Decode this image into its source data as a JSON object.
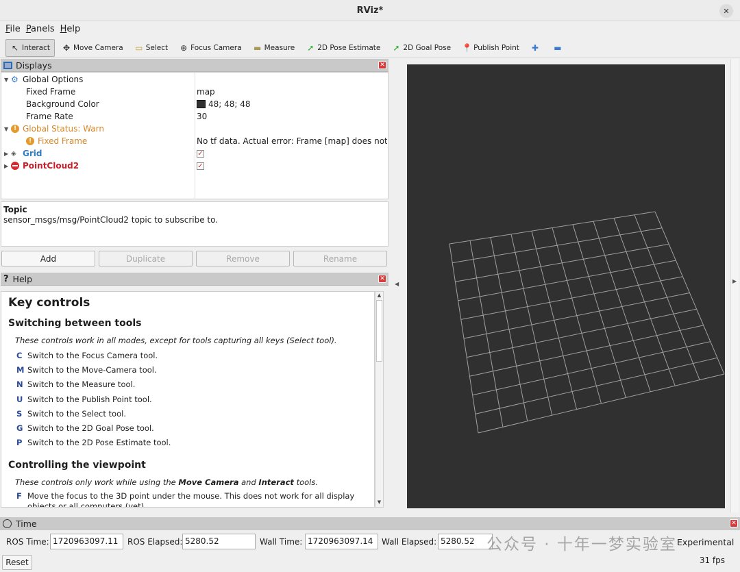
{
  "window": {
    "title": "RViz*"
  },
  "menu": [
    "File",
    "Panels",
    "Help"
  ],
  "toolbar": [
    {
      "label": "Interact",
      "icon": "interact-icon",
      "glyph": "↖",
      "color": "#333"
    },
    {
      "label": "Move Camera",
      "icon": "move-camera-icon",
      "glyph": "✥",
      "color": "#333"
    },
    {
      "label": "Select",
      "icon": "select-icon",
      "glyph": "▭",
      "color": "#c9a23a"
    },
    {
      "label": "Focus Camera",
      "icon": "focus-camera-icon",
      "glyph": "⊕",
      "color": "#333"
    },
    {
      "label": "Measure",
      "icon": "measure-icon",
      "glyph": "▬",
      "color": "#a89a5a"
    },
    {
      "label": "2D Pose Estimate",
      "icon": "pose-estimate-icon",
      "glyph": "➚",
      "color": "#22aa22"
    },
    {
      "label": "2D Goal Pose",
      "icon": "goal-pose-icon",
      "glyph": "➚",
      "color": "#22aa22"
    },
    {
      "label": "Publish Point",
      "icon": "publish-point-icon",
      "glyph": "📍",
      "color": "#c83a2a"
    },
    {
      "label": "",
      "icon": "add-tool-icon",
      "glyph": "✚",
      "color": "#3a7ad0"
    },
    {
      "label": "",
      "icon": "remove-tool-icon",
      "glyph": "▬",
      "color": "#3a7ad0"
    }
  ],
  "displays": {
    "title": "Displays",
    "global_options": "Global Options",
    "fixed_frame_label": "Fixed Frame",
    "fixed_frame_value": "map",
    "bg_color_label": "Background Color",
    "bg_color_value": "48; 48; 48",
    "frame_rate_label": "Frame Rate",
    "frame_rate_value": "30",
    "global_status": "Global Status: Warn",
    "status_fixed_frame": "Fixed Frame",
    "status_fixed_frame_value": "No tf data.  Actual error: Frame [map] does not…",
    "grid": "Grid",
    "pointcloud": "PointCloud2"
  },
  "description": {
    "heading": "Topic",
    "text": "sensor_msgs/msg/PointCloud2 topic to subscribe to."
  },
  "buttons": {
    "add": "Add",
    "duplicate": "Duplicate",
    "remove": "Remove",
    "rename": "Rename"
  },
  "help": {
    "title": "Help",
    "h1": "Key controls",
    "s1_title": "Switching between tools",
    "s1_note": "These controls work in all modes, except for tools capturing all keys (Select tool).",
    "keys": [
      {
        "k": "C",
        "d": "Switch to the Focus Camera tool."
      },
      {
        "k": "M",
        "d": "Switch to the Move-Camera tool."
      },
      {
        "k": "N",
        "d": "Switch to the Measure tool."
      },
      {
        "k": "U",
        "d": "Switch to the Publish Point tool."
      },
      {
        "k": "S",
        "d": "Switch to the Select tool."
      },
      {
        "k": "G",
        "d": "Switch to the 2D Goal Pose tool."
      },
      {
        "k": "P",
        "d": "Switch to the 2D Pose Estimate tool."
      }
    ],
    "s2_title": "Controlling the viewpoint",
    "s2_note_a": "These controls only work while using the ",
    "s2_note_b": "Move Camera",
    "s2_note_c": " and ",
    "s2_note_d": "Interact",
    "s2_note_e": " tools.",
    "f_key": "F",
    "f_text": "Move the focus to the 3D point under the mouse. This does not work for all display",
    "f_text2": "objects or all computers (yet)"
  },
  "time": {
    "title": "Time",
    "ros_time_label": "ROS Time:",
    "ros_time": "1720963097.11",
    "ros_elapsed_label": "ROS Elapsed:",
    "ros_elapsed": "5280.52",
    "wall_time_label": "Wall Time:",
    "wall_time": "1720963097.14",
    "wall_elapsed_label": "Wall Elapsed:",
    "wall_elapsed": "5280.52",
    "experimental": "Experimental",
    "reset": "Reset",
    "fps": "31 fps"
  },
  "watermark": "公众号 · 十年一梦实验室",
  "colors": {
    "viewport_bg": "#303030",
    "grid": "#a0a0a0",
    "warn": "#d9862a",
    "error": "#c8202a"
  }
}
